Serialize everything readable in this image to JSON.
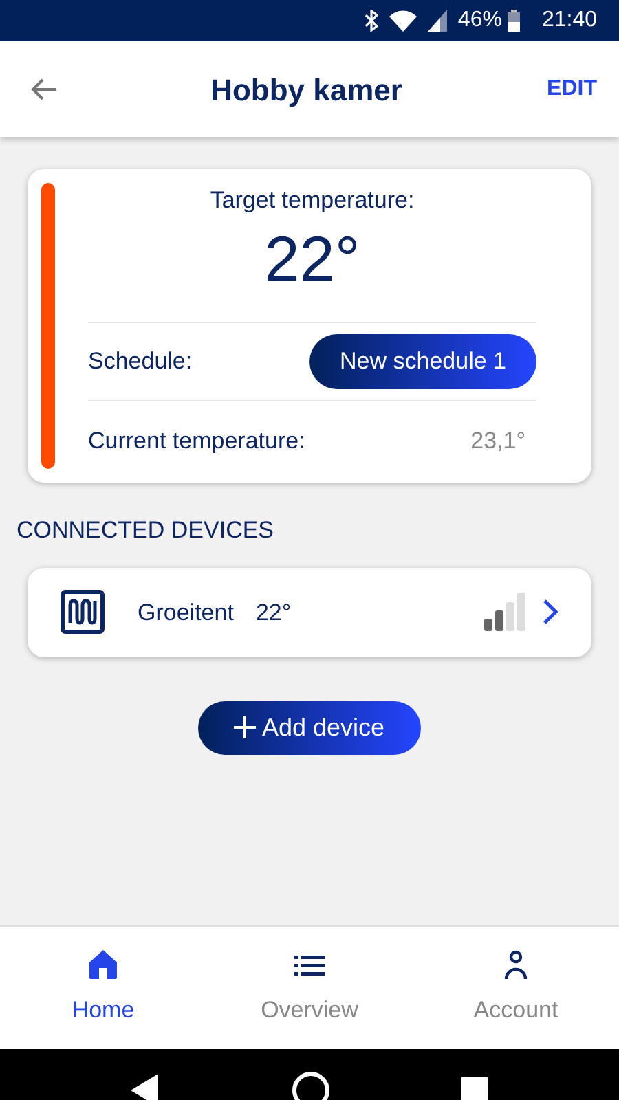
{
  "status_bar": {
    "battery": "46%",
    "time": "21:40"
  },
  "header": {
    "title": "Hobby kamer",
    "action": "EDIT"
  },
  "thermostat": {
    "target_label": "Target temperature:",
    "target_value": "22°",
    "schedule_label": "Schedule:",
    "schedule_button": "New schedule 1",
    "current_label": "Current temperature:",
    "current_value": "23,1°"
  },
  "connected_devices": {
    "title": "CONNECTED DEVICES",
    "devices": [
      {
        "name": "Groeitent",
        "temperature": "22°"
      }
    ]
  },
  "add_button": "Add device",
  "bottom_nav": [
    {
      "label": "Home",
      "selected": true
    },
    {
      "label": "Overview",
      "selected": false
    },
    {
      "label": "Account",
      "selected": false
    }
  ]
}
